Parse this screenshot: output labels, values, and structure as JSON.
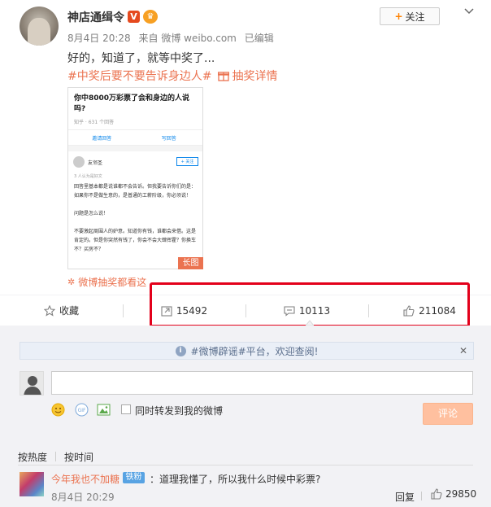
{
  "post": {
    "username": "神店通缉令",
    "verified_badge": "V",
    "meta": {
      "date": "8月4日 20:28",
      "source": "来自 微博 weibo.com",
      "edited": "已编辑"
    },
    "follow_label": "关注",
    "text": "好的，知道了，就等中奖了...",
    "topic": "#中奖后要不要告诉身边人#",
    "lottery_detail": "抽奖详情",
    "screenshot": {
      "title": "你中8000万彩票了会和身边的人说吗?",
      "sub": "知乎 · 631 个回答",
      "tab_invite": "邀请回答",
      "tab_write": "写回答",
      "user": "友邻圣",
      "follow": "+ 关注",
      "likes": "3 人认为是好文",
      "para1": "回答里基本都是说谁都不会告诉。但我要告诉你们的是：如果你不是做生意的，是普通的工薪阶级，你必须说！",
      "para2": "问题是怎么说！",
      "para3": "不要激起周围人的妒意。知道你有钱，谁都会来借。这是肯定的。但是你突然有钱了，你会不会大肆挥霍？你换车不？买房不？"
    },
    "long_image_badge": "长图",
    "lottery_link": "微博抽奖都看这",
    "icons": {
      "chevron": "chevron-down-icon",
      "lottery": "gift-icon",
      "flower": "flower-icon"
    }
  },
  "actions": {
    "favorite": "收藏",
    "forward_count": "15492",
    "comment_count": "10113",
    "like_count": "211084"
  },
  "comments": {
    "notice": "#微博辟谣#平台，欢迎查阅!",
    "input_value": "",
    "forward_checkbox_label": "同时转发到我的微博",
    "submit_label": "评论",
    "sort_hot": "按热度",
    "sort_time": "按时间",
    "items": [
      {
        "user": "今年我也不加糖",
        "badge": "铁粉",
        "text": "：道理我懂了，所以我什么时候中彩票?",
        "time": "8月4日 20:29",
        "reply_label": "回复",
        "likes": "29850"
      }
    ]
  },
  "colors": {
    "accent": "#eb7350",
    "highlight_box": "#e3001b",
    "submit_disabled": "#ffc09f",
    "fan_badge": "#58a3e3"
  }
}
